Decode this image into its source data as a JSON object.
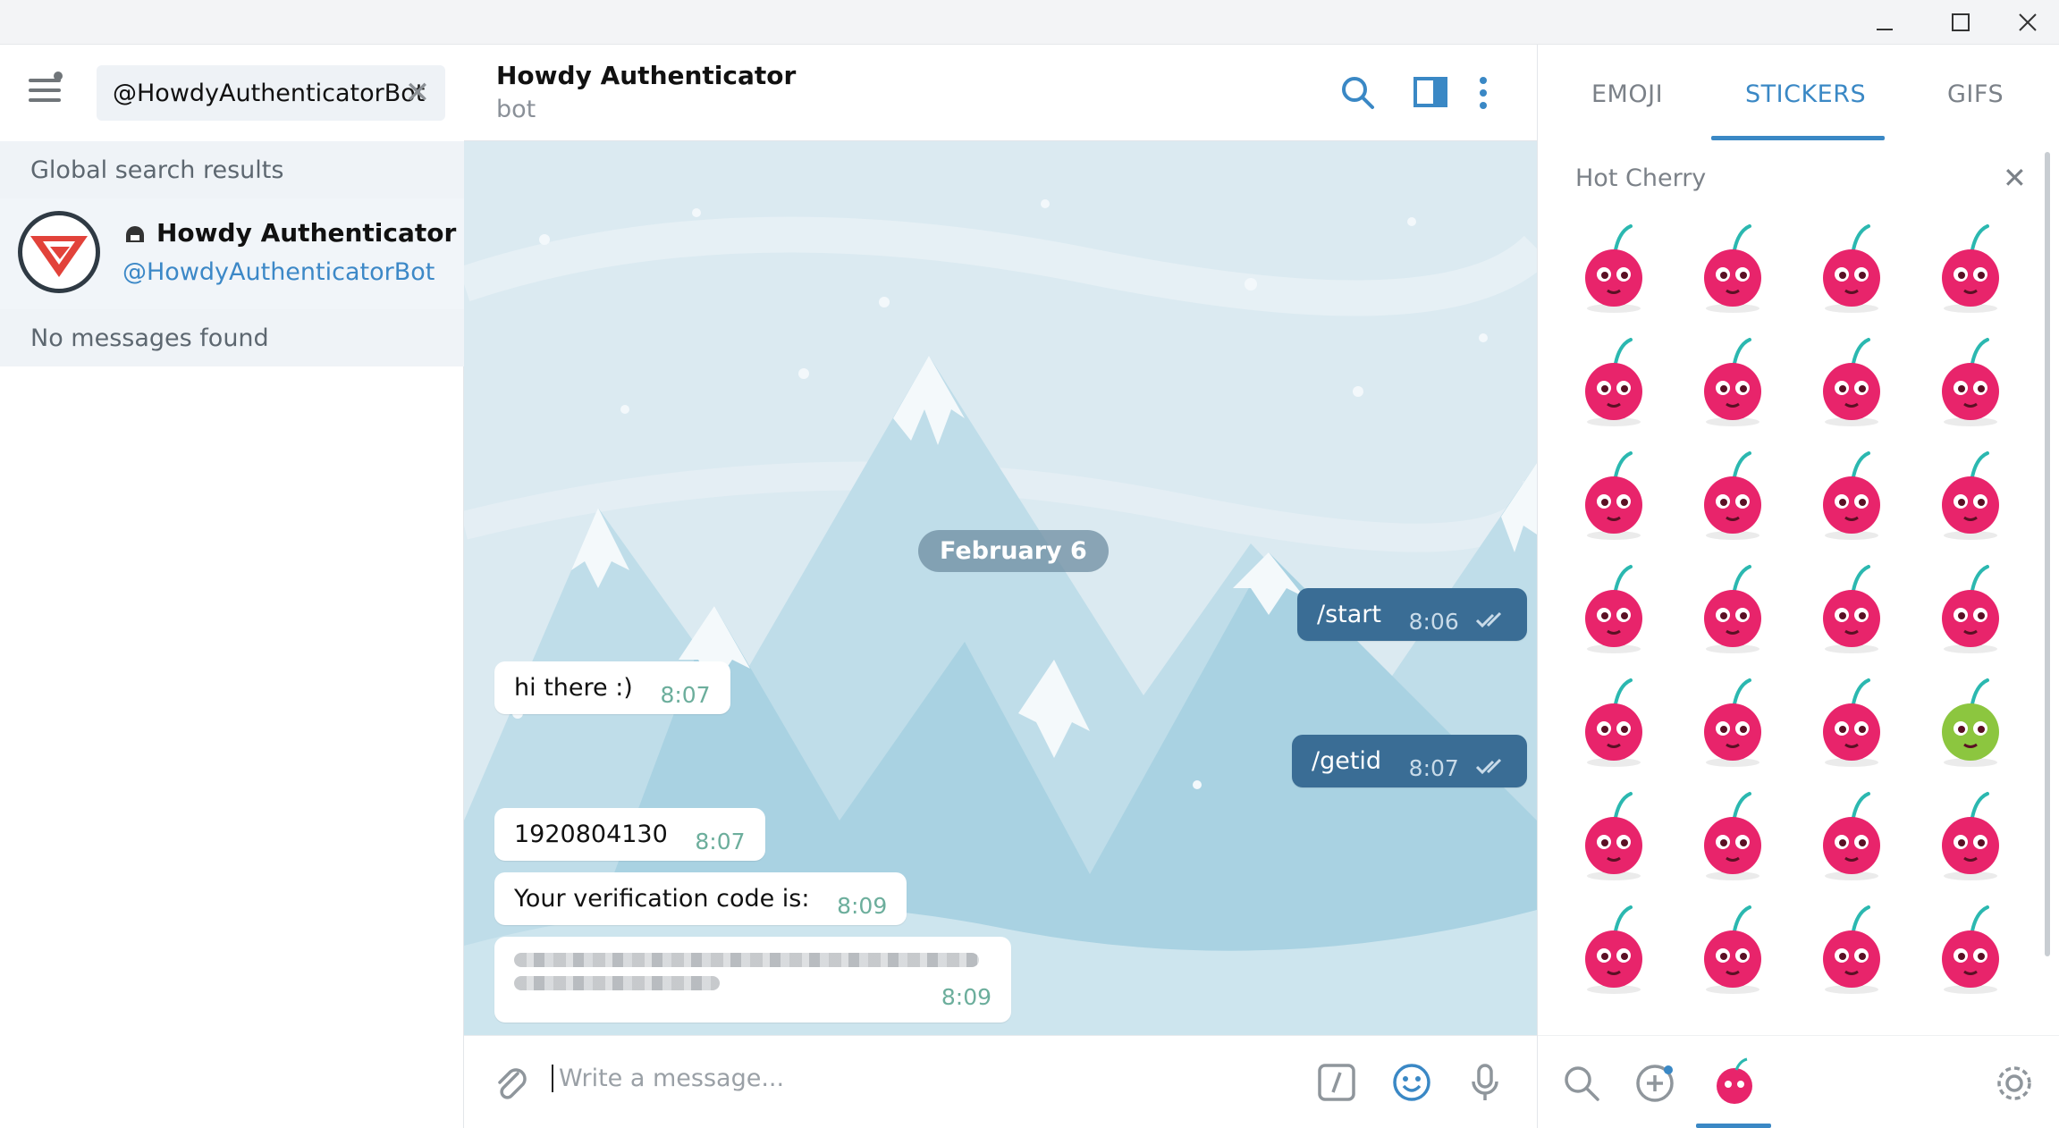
{
  "window": {
    "minimize_icon": "minimize-icon",
    "maximize_icon": "maximize-icon",
    "close_icon": "close-icon"
  },
  "left": {
    "search_value": "@HowdyAuthenticatorBot",
    "global_results_label": "Global search results",
    "result": {
      "name": "Howdy Authenticator",
      "username": "@HowdyAuthenticatorBot"
    },
    "no_messages_label": "No messages found"
  },
  "chat": {
    "title": "Howdy Authenticator",
    "subtitle": "bot",
    "date_pill": "February 6",
    "messages": [
      {
        "dir": "out",
        "text": "/start",
        "time": "8:06"
      },
      {
        "dir": "in",
        "text": "hi there :)",
        "time": "8:07"
      },
      {
        "dir": "out",
        "text": "/getid",
        "time": "8:07"
      },
      {
        "dir": "in",
        "text": "1920804130",
        "time": "8:07"
      },
      {
        "dir": "in",
        "text": "Your verification code is:",
        "time": "8:09"
      },
      {
        "dir": "in",
        "text": "",
        "time": "8:09"
      }
    ],
    "compose_placeholder": "Write a message..."
  },
  "stickers": {
    "tabs": [
      "EMOJI",
      "STICKERS",
      "GIFS"
    ],
    "active_tab": "STICKERS",
    "pack_title": "Hot Cherry",
    "count": 28
  },
  "colors": {
    "accent": "#3a88c5",
    "outgoing": "#3a6d95",
    "chat_bg": "#dbeaf1",
    "cherry": "#e8246b"
  }
}
